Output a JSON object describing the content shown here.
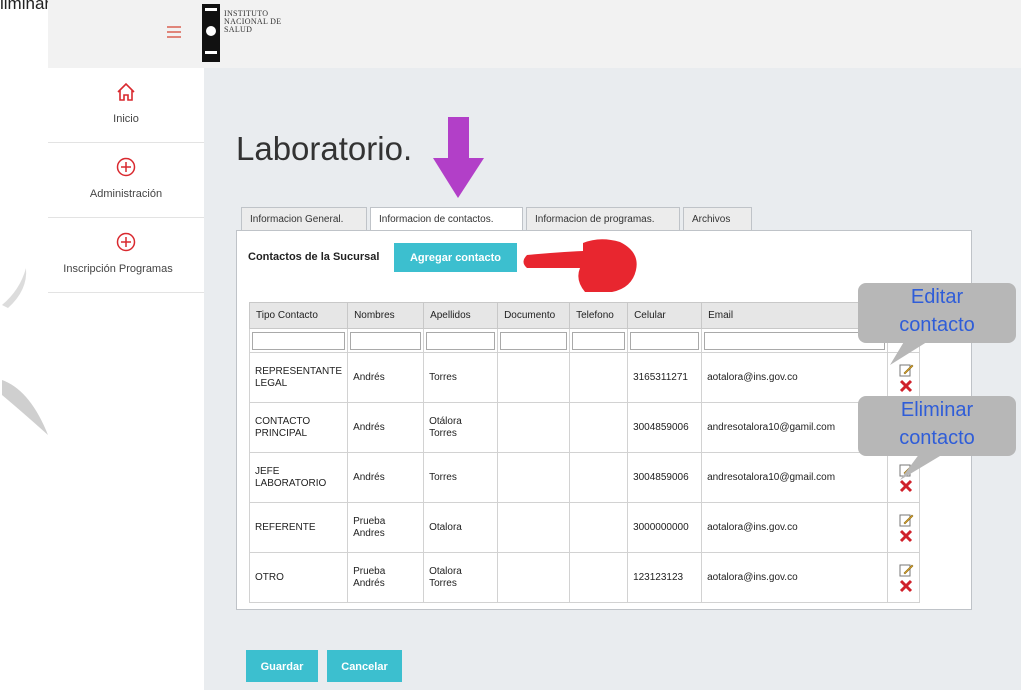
{
  "doc_heading": "liminar un contacto",
  "header": {
    "logo_line1": "INSTITUTO",
    "logo_line2": "NACIONAL DE",
    "logo_line3": "SALUD"
  },
  "sidebar": {
    "items": [
      {
        "label": "Inicio",
        "icon": "home-icon"
      },
      {
        "label": "Administración",
        "icon": "plus-circle-icon"
      },
      {
        "label": "Inscripción Programas",
        "icon": "plus-circle-icon"
      }
    ]
  },
  "page": {
    "title": "Laboratorio."
  },
  "tabs": [
    {
      "label": "Informacion General."
    },
    {
      "label": "Informacion de contactos.",
      "active": true
    },
    {
      "label": "Informacion de programas."
    },
    {
      "label": "Archivos"
    }
  ],
  "contacts": {
    "section_title": "Contactos de la Sucursal",
    "add_button": "Agregar contacto",
    "columns": [
      "Tipo Contacto",
      "Nombres",
      "Apellidos",
      "Documento",
      "Telefono",
      "Celular",
      "Email"
    ],
    "rows": [
      {
        "tipo": "REPRESENTANTE LEGAL",
        "nombres": "Andrés",
        "apellidos": "Torres",
        "documento": "",
        "telefono": "",
        "celular": "3165311271",
        "email": "aotalora@ins.gov.co"
      },
      {
        "tipo": "CONTACTO PRINCIPAL",
        "nombres": "Andrés",
        "apellidos": "Otálora Torres",
        "documento": "",
        "telefono": "",
        "celular": "3004859006",
        "email": "andresotalora10@gamil.com"
      },
      {
        "tipo": "JEFE LABORATORIO",
        "nombres": "Andrés",
        "apellidos": "Torres",
        "documento": "",
        "telefono": "",
        "celular": "3004859006",
        "email": "andresotalora10@gmail.com"
      },
      {
        "tipo": "REFERENTE",
        "nombres": "Prueba Andres",
        "apellidos": "Otalora",
        "documento": "",
        "telefono": "",
        "celular": "3000000000",
        "email": "aotalora@ins.gov.co"
      },
      {
        "tipo": "OTRO",
        "nombres": "Prueba Andrés",
        "apellidos": "Otalora Torres",
        "documento": "",
        "telefono": "",
        "celular": "123123123",
        "email": "aotalora@ins.gov.co"
      }
    ]
  },
  "footer": {
    "save_label": "Guardar",
    "cancel_label": "Cancelar"
  },
  "annotations": {
    "edit_callout_line1": "Editar",
    "edit_callout_line2": "contacto",
    "delete_callout_line1": "Eliminar",
    "delete_callout_line2": "contacto"
  },
  "colors": {
    "accent": "#3cbfcf",
    "main_bg": "#e9ecef",
    "arrow_purple": "#b23fc8",
    "arrow_red": "#e8262f",
    "callout_text": "#2f5dd8",
    "delete_red": "#d0202a"
  }
}
